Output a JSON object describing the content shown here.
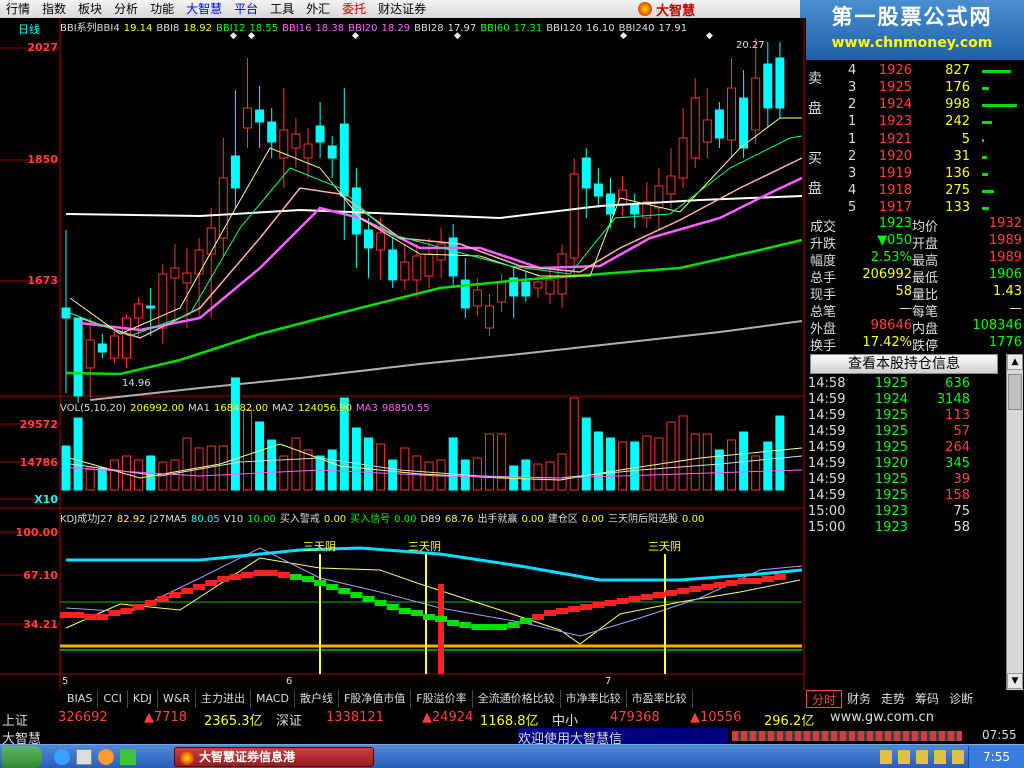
{
  "menu": {
    "items": [
      "行情",
      "指数",
      "板块",
      "分析",
      "功能",
      "大智慧",
      "平台",
      "工具",
      "外汇",
      "委托",
      "财达证券"
    ],
    "colors": [
      "#000",
      "#000",
      "#000",
      "#000",
      "#000",
      "#0000ff",
      "#0000ff",
      "#000",
      "#000",
      "#d00000",
      "#000"
    ]
  },
  "brand": {
    "name": "大智慧"
  },
  "logo": {
    "title": "第一股票公式网",
    "url": "www.chnmoney.com"
  },
  "main_chart": {
    "period": "日线",
    "legend": [
      {
        "t": "BBI系列BBI4",
        "c": "#ddd"
      },
      {
        "t": "19.14",
        "c": "#ffff00"
      },
      {
        "t": "BBI8",
        "c": "#ddd"
      },
      {
        "t": "18.92",
        "c": "#ffff00"
      },
      {
        "t": "BBI12",
        "c": "#00ff00"
      },
      {
        "t": "18.55",
        "c": "#00ff00"
      },
      {
        "t": "BBI16",
        "c": "#ff60ff"
      },
      {
        "t": "18.38",
        "c": "#ff60ff"
      },
      {
        "t": "BBI20",
        "c": "#ff60ff"
      },
      {
        "t": "18.29",
        "c": "#ff60ff"
      },
      {
        "t": "BBI28",
        "c": "#ddd"
      },
      {
        "t": "17.97",
        "c": "#ddd"
      },
      {
        "t": "BBI60",
        "c": "#00ff00"
      },
      {
        "t": "17.31",
        "c": "#00ff00"
      },
      {
        "t": "BBI120",
        "c": "#ddd"
      },
      {
        "t": "16.10",
        "c": "#ddd"
      },
      {
        "t": "BBI240",
        "c": "#ddd"
      },
      {
        "t": "17.91",
        "c": "#ddd"
      }
    ],
    "high_label": "20.27",
    "low_label": "14.96",
    "y_labels": [
      "2027",
      "1850",
      "1673"
    ]
  },
  "vol_chart": {
    "legend": [
      {
        "t": "VOL(5,10,20)",
        "c": "#ddd"
      },
      {
        "t": "206992.00",
        "c": "#ffff00"
      },
      {
        "t": "MA1",
        "c": "#ddd"
      },
      {
        "t": "168482.00",
        "c": "#ffff00"
      },
      {
        "t": "MA2",
        "c": "#ddd"
      },
      {
        "t": "124056.90",
        "c": "#ffff00"
      },
      {
        "t": "MA3",
        "c": "#ff60ff"
      },
      {
        "t": "98850.55",
        "c": "#ff60ff"
      }
    ],
    "y_labels": [
      "29572",
      "14786"
    ],
    "unit": "X10"
  },
  "kdj_chart": {
    "legend": [
      {
        "t": "KDJ成功J27",
        "c": "#ddd"
      },
      {
        "t": "82.92",
        "c": "#ffff00"
      },
      {
        "t": "J27MA5",
        "c": "#ddd"
      },
      {
        "t": "80.05",
        "c": "#00ffff"
      },
      {
        "t": "V10",
        "c": "#ddd"
      },
      {
        "t": "10.00",
        "c": "#00ff00"
      },
      {
        "t": "买入警戒",
        "c": "#ddd"
      },
      {
        "t": "0.00",
        "c": "#ffff00"
      },
      {
        "t": "买入信号",
        "c": "#00ff00"
      },
      {
        "t": "0.00",
        "c": "#00ff00"
      },
      {
        "t": "D89",
        "c": "#ddd"
      },
      {
        "t": "68.76",
        "c": "#ffff00"
      },
      {
        "t": "出手就赢",
        "c": "#ddd"
      },
      {
        "t": "0.00",
        "c": "#ffff00"
      },
      {
        "t": "建仓区",
        "c": "#ddd"
      },
      {
        "t": "0.00",
        "c": "#ffff00"
      },
      {
        "t": "三天阴后阳选股",
        "c": "#ddd"
      },
      {
        "t": "0.00",
        "c": "#ffff00"
      }
    ],
    "y_labels": [
      "100.00",
      "67.10",
      "34.21"
    ],
    "marker_label": "三天阴",
    "x_labels": [
      "5",
      "6",
      "7"
    ]
  },
  "orderbook": {
    "sell_label": "卖盘",
    "buy_label": "买盘",
    "sell": [
      {
        "lv": "4",
        "price": "1926",
        "vol": "827",
        "bar": 0.72
      },
      {
        "lv": "3",
        "price": "1925",
        "vol": "176",
        "bar": 0.18
      },
      {
        "lv": "2",
        "price": "1924",
        "vol": "998",
        "bar": 0.88
      },
      {
        "lv": "1",
        "price": "1923",
        "vol": "242",
        "bar": 0.25
      }
    ],
    "buy": [
      {
        "lv": "1",
        "price": "1921",
        "vol": "5",
        "bar": 0.05
      },
      {
        "lv": "2",
        "price": "1920",
        "vol": "31",
        "bar": 0.12
      },
      {
        "lv": "3",
        "price": "1919",
        "vol": "136",
        "bar": 0.15
      },
      {
        "lv": "4",
        "price": "1918",
        "vol": "275",
        "bar": 0.3
      },
      {
        "lv": "5",
        "price": "1917",
        "vol": "133",
        "bar": 0.18
      }
    ]
  },
  "stats": [
    {
      "k": "成交",
      "v1": "1923",
      "c1": "#00ff00",
      "k2": "均价",
      "v2": "1932",
      "c2": "#ff4040"
    },
    {
      "k": "升跌",
      "v1": "▼050",
      "c1": "#00ff00",
      "k2": "开盘",
      "v2": "1989",
      "c2": "#ff4040"
    },
    {
      "k": "幅度",
      "v1": "2.53%",
      "c1": "#00ff00",
      "k2": "最高",
      "v2": "1989",
      "c2": "#ff4040"
    },
    {
      "k": "总手",
      "v1": "206992",
      "c1": "#ffff00",
      "k2": "最低",
      "v2": "1906",
      "c2": "#00ff00"
    },
    {
      "k": "现手",
      "v1": "58",
      "c1": "#ffff00",
      "k2": "量比",
      "v2": "1.43",
      "c2": "#ffff00"
    },
    {
      "k": "总笔",
      "v1": "—",
      "c1": "#ddd",
      "k2": "每笔",
      "v2": "—",
      "c2": "#ddd"
    },
    {
      "k": "外盘",
      "v1": "98646",
      "c1": "#ff4040",
      "k2": "内盘",
      "v2": "108346",
      "c2": "#00ff00"
    },
    {
      "k": "换手",
      "v1": "17.42%",
      "c1": "#ffff00",
      "k2": "跌停",
      "v2": "1776",
      "c2": "#00ff00"
    }
  ],
  "hold_button": "查看本股持仓信息",
  "ticks": [
    {
      "t": "14:58",
      "p": "1925",
      "v": "636",
      "c": "#00ff00"
    },
    {
      "t": "14:59",
      "p": "1924",
      "v": "3148",
      "c": "#00ff00"
    },
    {
      "t": "14:59",
      "p": "1925",
      "v": "113",
      "c": "#ff4040"
    },
    {
      "t": "14:59",
      "p": "1925",
      "v": "57",
      "c": "#ff4040"
    },
    {
      "t": "14:59",
      "p": "1925",
      "v": "264",
      "c": "#ff4040"
    },
    {
      "t": "14:59",
      "p": "1920",
      "v": "345",
      "c": "#00ff00"
    },
    {
      "t": "14:59",
      "p": "1925",
      "v": "39",
      "c": "#ff4040"
    },
    {
      "t": "14:59",
      "p": "1925",
      "v": "158",
      "c": "#ff4040"
    },
    {
      "t": "15:00",
      "p": "1923",
      "v": "75",
      "c": "#ddd"
    },
    {
      "t": "15:00",
      "p": "1923",
      "v": "58",
      "c": "#ddd"
    }
  ],
  "indicator_tabs": [
    "BIAS",
    "CCI",
    "KDJ",
    "W&R",
    "主力进出",
    "MACD",
    "散户线",
    "F股净值市值",
    "F股溢价率",
    "全流通价格比较",
    "市净率比较",
    "市盈率比较"
  ],
  "right_tabs": [
    "分时",
    "财务",
    "走势",
    "筹码",
    "诊断"
  ],
  "index_bar": {
    "sh_label": "上证",
    "sh_val": "326692",
    "sh_chg": "▲7718",
    "sh_amt": "2365.3亿",
    "sz_label": "深证",
    "sz_val": "1338121",
    "sz_chg": "▲24924",
    "sz_amt": "1168.8亿",
    "zx_label": "中小",
    "zx_val": "479368",
    "zx_chg": "▲10556",
    "zx_amt": "296.2亿",
    "site": "www.gw.com.cn"
  },
  "status": {
    "app": "大智慧",
    "welcome": "欢迎使用大智慧信",
    "time": "07:55"
  },
  "taskbar": {
    "task": "大智慧证券信息港",
    "clock": "7:55"
  },
  "colors": {
    "up": "#ff4040",
    "down": "#00ffff",
    "green": "#00ff00",
    "yellow": "#ffff00"
  }
}
